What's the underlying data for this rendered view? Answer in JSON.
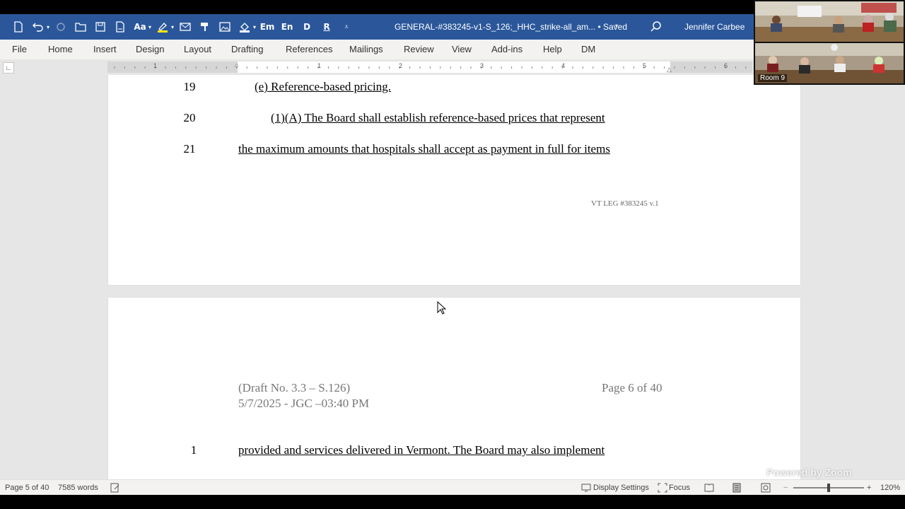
{
  "titlebar": {
    "document_title": "GENERAL-#383245-v1-S_126;_HHC_strike-all_am... • Saved",
    "user_name": "Jennifer Carbee",
    "qat": [
      "Em",
      "En",
      "D",
      "R"
    ],
    "font_size_btn": "Aa"
  },
  "ribbon": {
    "tabs": [
      "File",
      "Home",
      "Insert",
      "Design",
      "Layout",
      "Drafting",
      "References",
      "Mailings",
      "Review",
      "View",
      "Add-ins",
      "Help",
      "DM"
    ]
  },
  "ruler": {
    "numbers": [
      "1",
      "1",
      "2",
      "3",
      "4",
      "5",
      "6"
    ]
  },
  "document": {
    "page5": {
      "lines": [
        {
          "num": "19",
          "text": "(e)  Reference-based pricing."
        },
        {
          "num": "20",
          "text": "(1)(A)  The Board shall establish reference-based prices that represent"
        },
        {
          "num": "21",
          "text": "the maximum amounts that hospitals shall accept as payment in full for items"
        }
      ],
      "footer": "VT LEG #383245 v.1"
    },
    "page6": {
      "header_left_1": "(Draft No. 3.3 – S.126)",
      "header_left_2": "5/7/2025 - JGC –03:40 PM",
      "header_right": "Page 6 of 40",
      "lines": [
        {
          "num": "1",
          "text": "provided and services delivered in Vermont.  The Board may also implement"
        }
      ]
    }
  },
  "statusbar": {
    "page": "Page 5 of 40",
    "words": "7585 words",
    "display_settings": "Display Settings",
    "focus": "Focus",
    "zoom": "120%",
    "zoom_minus": "−",
    "zoom_plus": "+"
  },
  "video": {
    "room_label": "Room 9"
  },
  "zoom_brand": "Powered by Zoom",
  "colors": {
    "titlebar": "#2b579a",
    "ribbon": "#f3f2f1",
    "canvas": "#e6e6e6"
  }
}
